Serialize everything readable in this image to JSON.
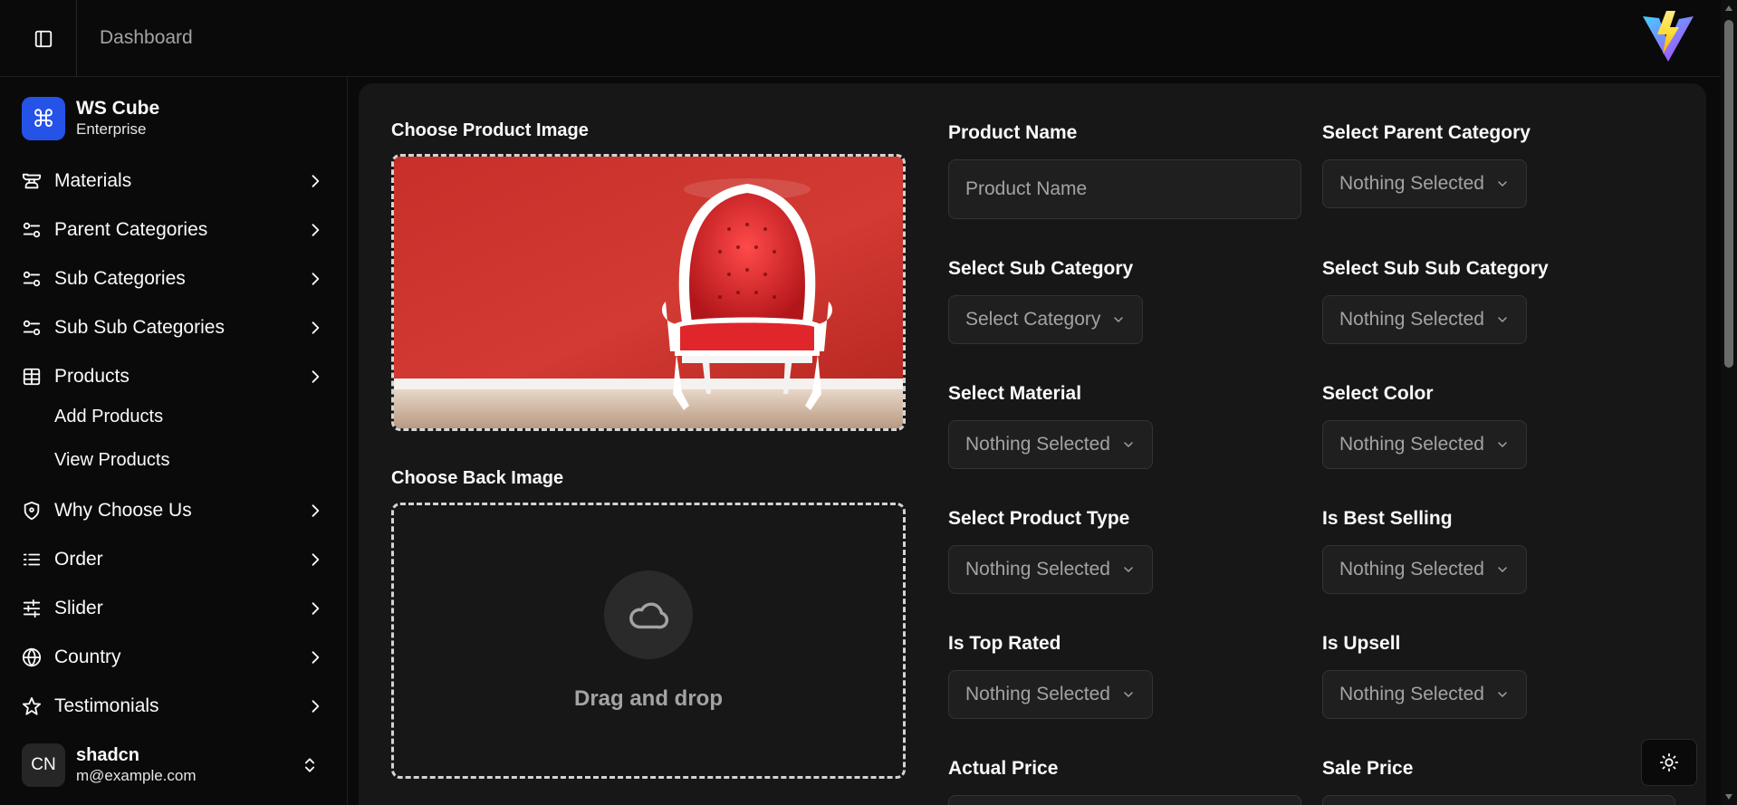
{
  "header": {
    "title": "Dashboard"
  },
  "brand": {
    "name": "WS Cube",
    "plan": "Enterprise"
  },
  "sidebar": {
    "items": [
      {
        "label": "Materials",
        "icon": "anvil-icon"
      },
      {
        "label": "Parent Categories",
        "icon": "sliders-icon"
      },
      {
        "label": "Sub Categories",
        "icon": "sliders-icon"
      },
      {
        "label": "Sub Sub Categories",
        "icon": "sliders-icon"
      },
      {
        "label": "Products",
        "icon": "table-icon"
      },
      {
        "label": "Why Choose Us",
        "icon": "shield-icon"
      },
      {
        "label": "Order",
        "icon": "list-icon"
      },
      {
        "label": "Slider",
        "icon": "sliders-horizontal-icon"
      },
      {
        "label": "Country",
        "icon": "globe-icon"
      },
      {
        "label": "Testimonials",
        "icon": "star-icon"
      }
    ],
    "products_sub": [
      "Add Products",
      "View Products"
    ]
  },
  "user": {
    "initials": "CN",
    "name": "shadcn",
    "email": "m@example.com"
  },
  "form": {
    "product_image_label": "Choose Product Image",
    "back_image_label": "Choose Back Image",
    "drag_drop": "Drag and drop",
    "product_name": {
      "label": "Product Name",
      "placeholder": "Product Name"
    },
    "parent_category": {
      "label": "Select Parent Category",
      "value": "Nothing Selected"
    },
    "sub_category": {
      "label": "Select Sub Category",
      "value": "Select Category"
    },
    "sub_sub_category": {
      "label": "Select Sub Sub Category",
      "value": "Nothing Selected"
    },
    "material": {
      "label": "Select Material",
      "value": "Nothing Selected"
    },
    "color": {
      "label": "Select Color",
      "value": "Nothing Selected"
    },
    "product_type": {
      "label": "Select Product Type",
      "value": "Nothing Selected"
    },
    "best_selling": {
      "label": "Is Best Selling",
      "value": "Nothing Selected"
    },
    "top_rated": {
      "label": "Is Top Rated",
      "value": "Nothing Selected"
    },
    "upsell": {
      "label": "Is Upsell",
      "value": "Nothing Selected"
    },
    "actual_price": {
      "label": "Actual Price"
    },
    "sale_price": {
      "label": "Sale Price"
    }
  },
  "colors": {
    "accent": "#2553e8",
    "background": "#0a0a0a",
    "panel": "#171717"
  }
}
